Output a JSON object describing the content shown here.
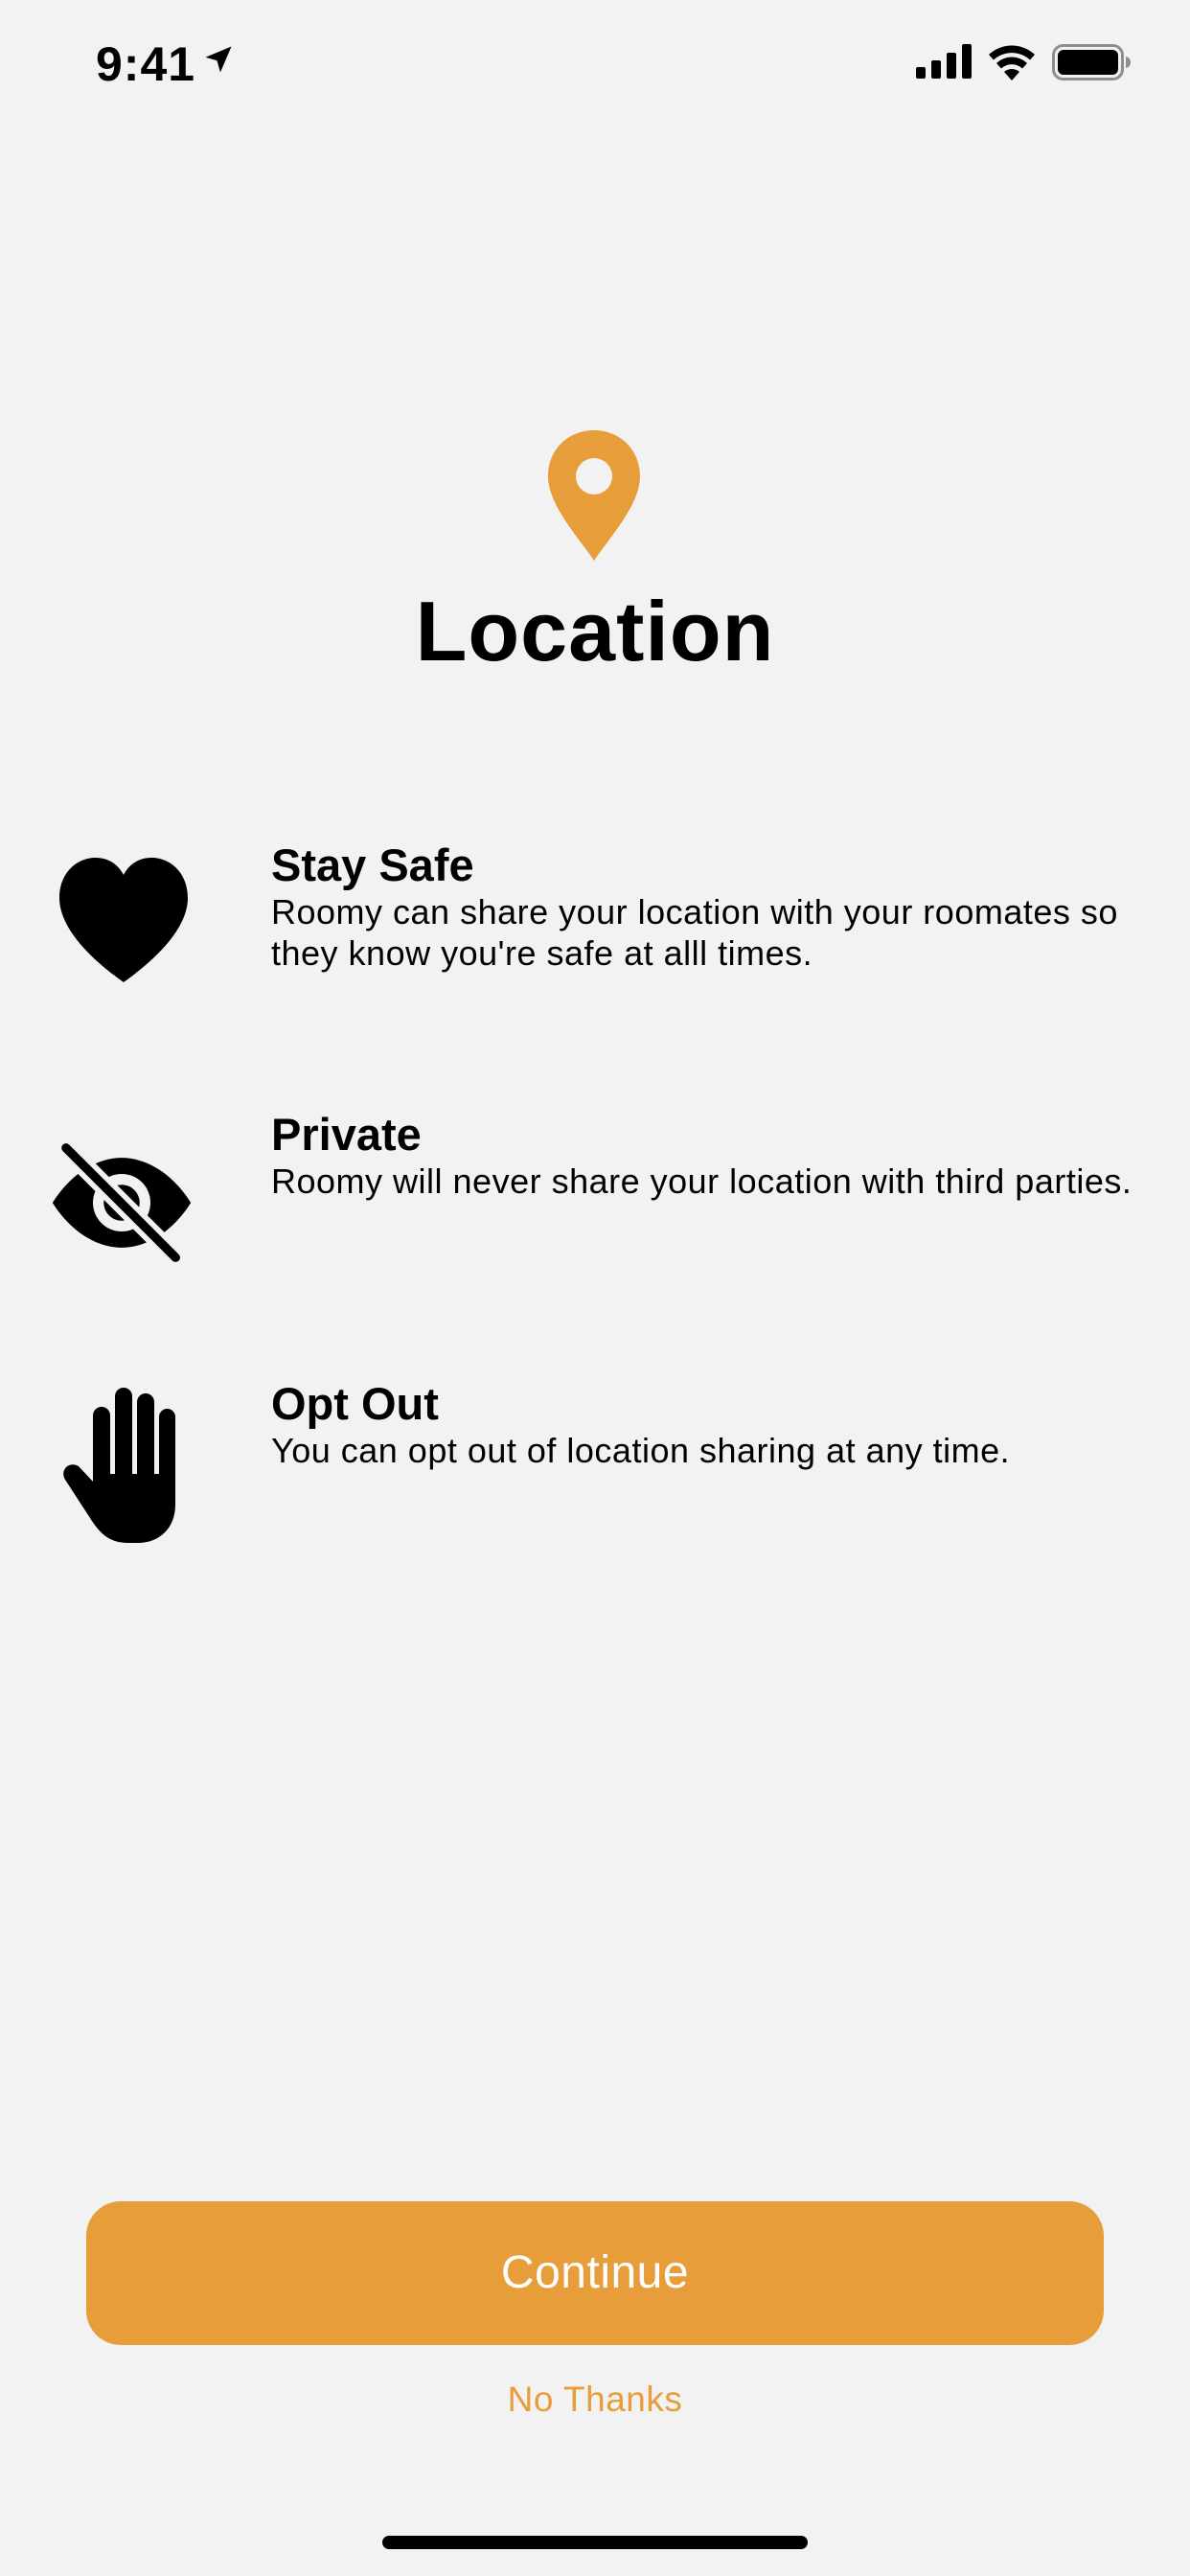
{
  "status_bar": {
    "time": "9:41",
    "icons": [
      "location-arrow-icon",
      "cellular-signal-icon",
      "wifi-icon",
      "battery-icon"
    ]
  },
  "header": {
    "icon": "map-pin-icon",
    "title": "Location"
  },
  "features": [
    {
      "icon": "heart-icon",
      "title": "Stay Safe",
      "description_lines": [
        "Roomy can share your location with your roomates so",
        "they know you're safe at alll times."
      ]
    },
    {
      "icon": "eye-slash-icon",
      "title": "Private",
      "description_lines": [
        "Roomy will never share your location with third parties."
      ]
    },
    {
      "icon": "raised-hand-icon",
      "title": "Opt Out",
      "description_lines": [
        "You can opt out of location sharing at any time."
      ]
    }
  ],
  "actions": {
    "continue_label": "Continue",
    "no_thanks_label": "No Thanks"
  },
  "colors": {
    "accent": "#e89d3b",
    "background": "#f2f2f2",
    "text": "#000000",
    "button_text": "#ffffff"
  }
}
